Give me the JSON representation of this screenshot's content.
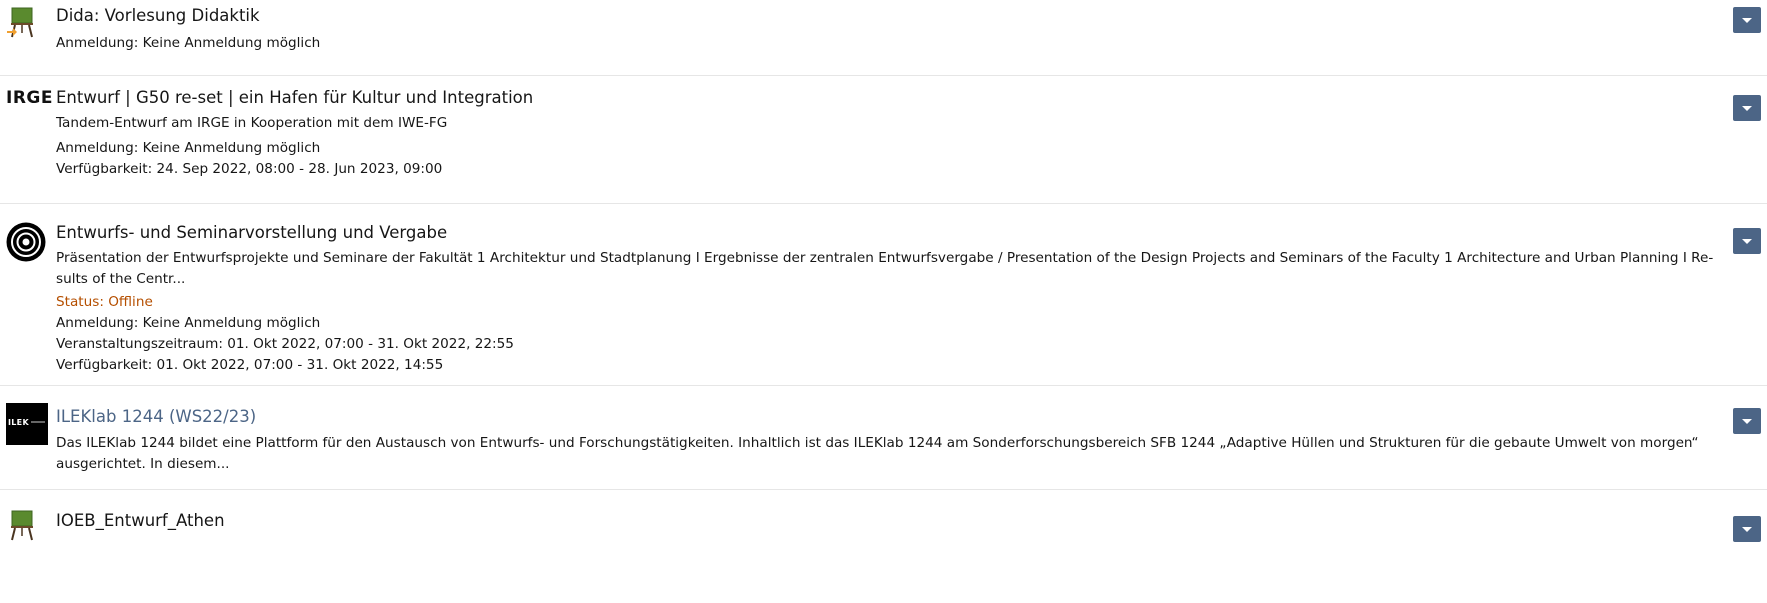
{
  "items": [
    {
      "title": "Dida: Vorlesung Didaktik",
      "properties": [
        "Anmeldung: Keine Anmeldung möglich"
      ],
      "icon": "course-board-icon"
    },
    {
      "logo_text": "IRGE",
      "title": "Entwurf | G50 re-set | ein Hafen für Kultur und Integration",
      "description": "Tandem-Entwurf am IRGE in Kooperation mit dem IWE-FG",
      "properties": [
        "Anmeldung: Keine Anmeldung möglich",
        "Verfügbarkeit: 24. Sep 2022, 08:00 - 28. Jun 2023, 09:00"
      ]
    },
    {
      "title": "Entwurfs- und Seminarvorstellung und Vergabe",
      "description_line1": "Präsentation der Entwurfsprojekte und Seminare der Fakultät 1 Architektur und Stadtplanung I Ergebnisse der zentralen Entwurfsvergabe / Presentation of the Design Projects and Seminars of the Faculty 1 Architecture and Urban Planning I Re-",
      "description_line2": "sults of the Centr...",
      "status": "Status: Offline",
      "properties": [
        "Anmeldung: Keine Anmeldung möglich",
        "Veranstaltungszeitraum: 01. Okt 2022, 07:00 - 31. Okt 2022, 22:55",
        "Verfügbarkeit: 01. Okt 2022, 07:00 - 31. Okt 2022, 14:55"
      ],
      "icon": "target-rings-icon"
    },
    {
      "logo_text": "ILEK",
      "title": "ILEKlab 1244 (WS22/23)",
      "description_line1": "Das ILEKlab 1244 bildet eine Plattform für den Austausch von Entwurfs- und Forschungstätigkeiten. Inhaltlich ist das ILEKlab 1244 am Sonderforschungsbereich SFB 1244 „Adaptive Hüllen und Strukturen für die gebaute Umwelt von morgen“",
      "description_line2": "ausgerichtet. In diesem..."
    },
    {
      "title": "IOEB_Entwurf_Athen",
      "icon": "course-board-icon"
    }
  ],
  "colors": {
    "accent": "#4c6586",
    "status_offline": "#b54f00",
    "board_green": "#5a8a2e",
    "board_orange": "#f0a030"
  },
  "actions_icon": "caret-down-icon"
}
